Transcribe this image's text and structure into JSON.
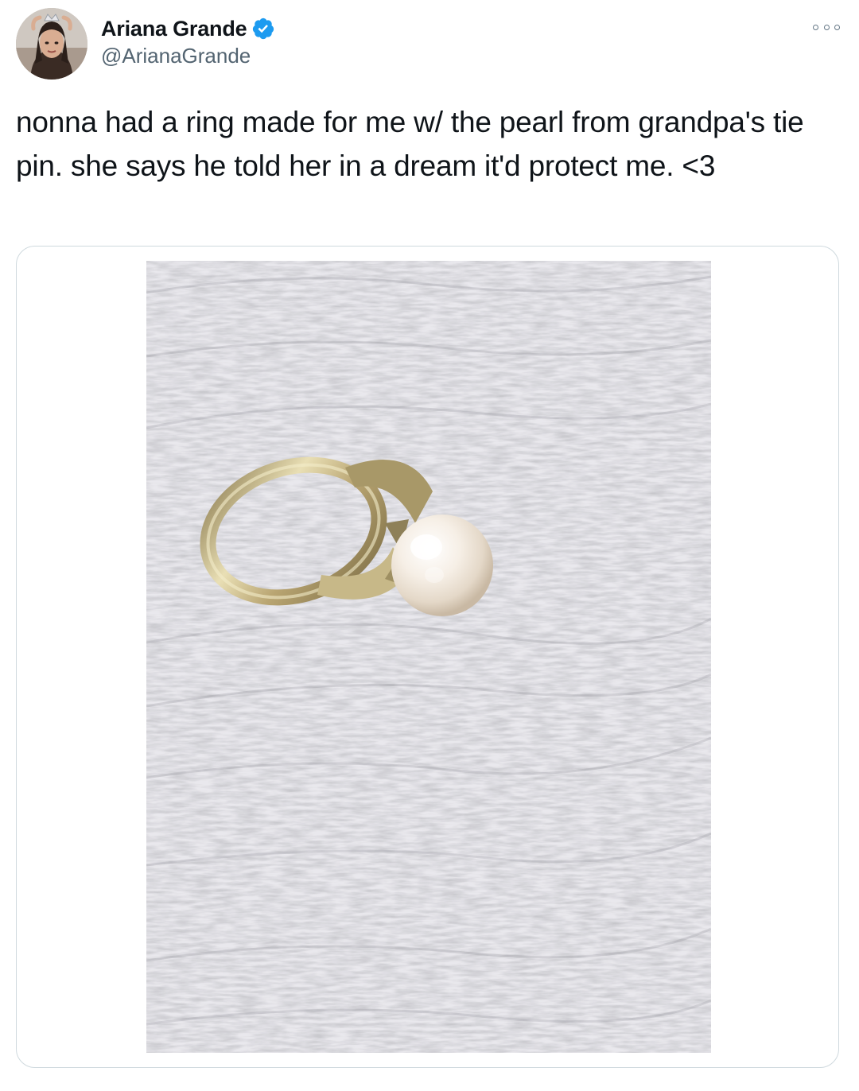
{
  "tweet": {
    "author": {
      "display_name": "Ariana Grande",
      "handle": "@ArianaGrande",
      "verified": true,
      "avatar_icon": "profile-photo-icon"
    },
    "more_options_icon": "ellipsis-icon",
    "text": "nonna had a ring made for me w/ the pearl from grandpa's tie pin. she says he told her in a dream it'd protect me. <3",
    "media": {
      "type": "photo",
      "icon": "photo-pearl-ring"
    }
  },
  "colors": {
    "text_primary": "#0f1419",
    "text_secondary": "#536471",
    "verified_badge": "#1d9bf0",
    "card_border": "#cfd9de"
  }
}
